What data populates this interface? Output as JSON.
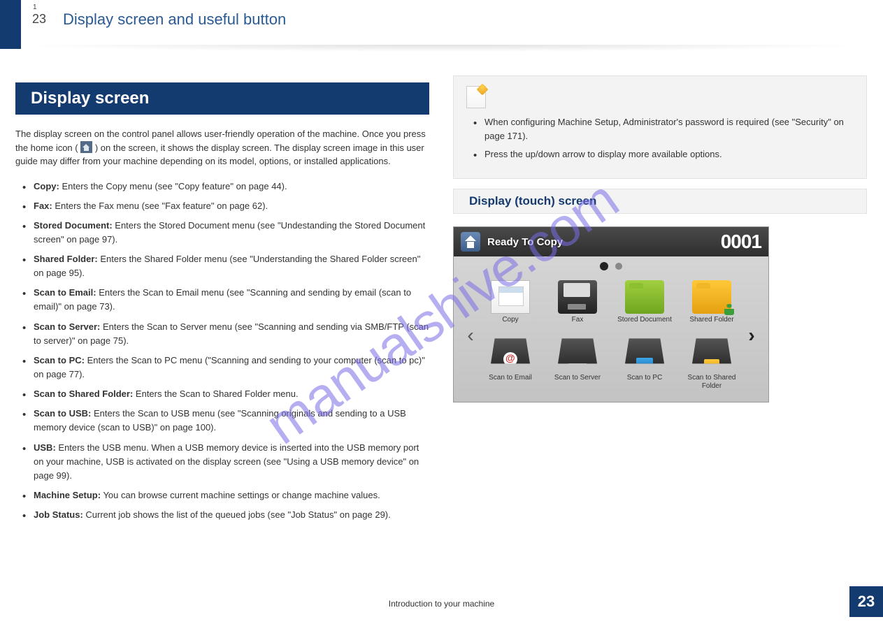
{
  "header": {
    "chapter_small": "1",
    "chapter_big": "23",
    "title": "Display screen and useful button"
  },
  "section_heading": "Display screen",
  "intro_p1": "The display screen on the control panel allows user-friendly operation of the machine. Once you press the home icon (",
  "intro_p2": ") on the screen, it shows the display screen. The display screen image in this user guide may differ from your machine depending on its model, options, or installed applications.",
  "bullets": [
    {
      "label": "Copy:",
      "text": " Enters the Copy menu (see \"Copy feature\" on page 44)."
    },
    {
      "label": "Fax:",
      "text": " Enters the Fax menu (see \"Fax feature\" on page 62)."
    },
    {
      "label": "Stored Document:",
      "text": " Enters the Stored Document menu (see \"Undestanding the Stored Document screen\" on page 97)."
    },
    {
      "label": "Shared Folder:",
      "text": " Enters the Shared Folder menu (see \"Understanding the Shared Folder screen\" on page 95)."
    },
    {
      "label": "Scan to Email:",
      "text": " Enters the Scan to Email menu (see \"Scanning and sending by email (scan to email)\" on page 73)."
    },
    {
      "label": "Scan to Server:",
      "text": " Enters the Scan to Server menu (see \"Scanning and sending via SMB/FTP (scan to server)\" on page 75)."
    },
    {
      "label": "Scan to PC:",
      "text": " Enters the Scan to PC menu (\"Scanning and sending to your computer (scan to pc)\" on page 77)."
    },
    {
      "label": "Scan to Shared Folder:",
      "text": " Enters the Scan to Shared Folder menu."
    },
    {
      "label": "Scan to USB:",
      "text": " Enters the Scan to USB menu (see \"Scanning originals and sending to a USB memory device (scan to USB)\" on page 100)."
    },
    {
      "label": "USB:",
      "text": " Enters the USB menu. When a USB memory device is inserted into the USB memory port on your machine, USB is activated on the display screen (see \"Using a USB memory device\" on page 99)."
    },
    {
      "label": "Machine Setup:",
      "text": " You can browse current machine settings or change machine values."
    },
    {
      "label": "Job Status:",
      "text": " Current job shows the list of the queued jobs (see \"Job Status\" on page 29)."
    }
  ],
  "notes": [
    "When configuring Machine Setup, Administrator's password is required (see \"Security\" on page 171).",
    "Press the up/down arrow to display more available options."
  ],
  "panel_section_title": "Display (touch) screen",
  "panel_status": "Ready To Copy",
  "panel_count": "0001",
  "apps": [
    {
      "name": "Copy"
    },
    {
      "name": "Fax"
    },
    {
      "name": "Stored Document"
    },
    {
      "name": "Shared Folder"
    },
    {
      "name": "Scan to Email"
    },
    {
      "name": "Scan to Server"
    },
    {
      "name": "Scan to PC"
    },
    {
      "name": "Scan to Shared Folder"
    }
  ],
  "footer": "Introduction to your machine",
  "page_number": "23",
  "watermark": "manualshive.com"
}
